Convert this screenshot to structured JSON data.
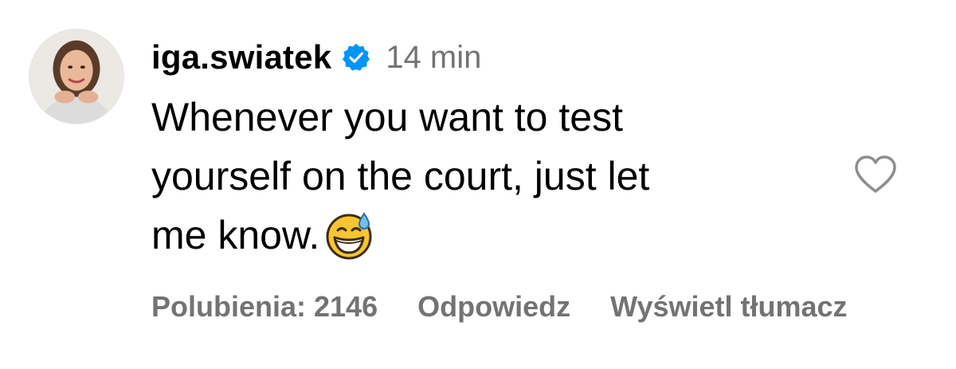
{
  "comment": {
    "username": "iga.swiatek",
    "verified_icon": "verified-badge-icon",
    "time": "14 min",
    "text_lines": [
      "Whenever you want to test",
      "yourself on the court, just let",
      "me know."
    ],
    "emoji": "😅",
    "like_icon": "heart-outline-icon",
    "likes_label": "Polubienia: 2146",
    "reply_label": "Odpowiedz",
    "translate_label": "Wyświetl tłumacz"
  },
  "colors": {
    "text": "#000000",
    "secondary": "#737373",
    "verified_blue": "#0095f6",
    "heart_stroke": "#8e8e8e"
  }
}
